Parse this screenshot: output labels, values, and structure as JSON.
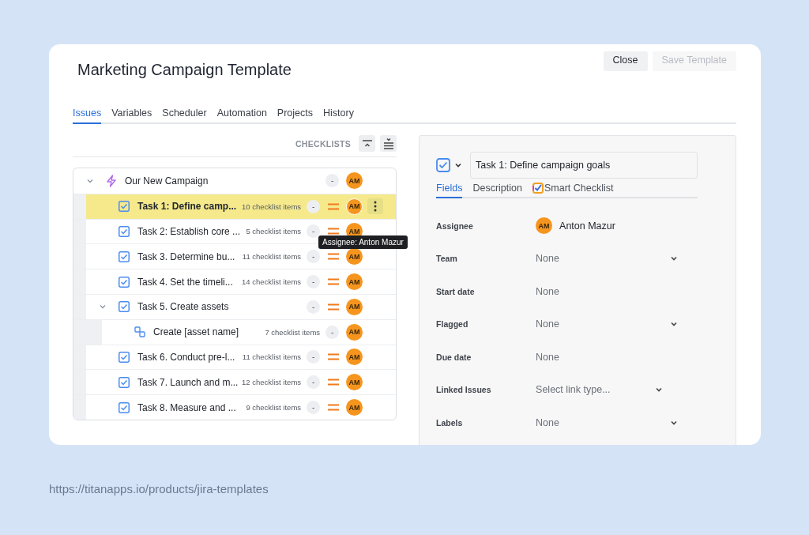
{
  "dialog": {
    "title": "Marketing Campaign Template",
    "buttons": [
      {
        "label": "Close",
        "disabled": false
      },
      {
        "label": "Save Template",
        "disabled": true
      }
    ]
  },
  "tabs": [
    {
      "label": "Issues",
      "selected": true
    },
    {
      "label": "Variables",
      "selected": false
    },
    {
      "label": "Scheduler",
      "selected": false
    },
    {
      "label": "Automation",
      "selected": false
    },
    {
      "label": "Projects",
      "selected": false
    },
    {
      "label": "History",
      "selected": false
    }
  ],
  "checklists_toolbar": {
    "label": "CHECKLISTS"
  },
  "tree": [
    {
      "kind": "epic",
      "title": "Our New Campaign",
      "status": "-",
      "assignee": "AM",
      "expanded": true,
      "selected": false,
      "children": [
        {
          "kind": "task",
          "title": "Task 1: Define camp...",
          "checklist": "10 checklist items",
          "status": "-",
          "priority": true,
          "assignee": "AM",
          "selected": true
        },
        {
          "kind": "task",
          "title": "Task 2: Establish core ...",
          "checklist": "5 checklist items",
          "status": "-",
          "priority": true,
          "assignee": "AM",
          "selected": false
        },
        {
          "kind": "task",
          "title": "Task 3. Determine bu...",
          "checklist": "11 checklist items",
          "status": "-",
          "priority": true,
          "assignee": "AM",
          "selected": false
        },
        {
          "kind": "task",
          "title": "Task 4. Set the timeli...",
          "checklist": "14 checklist items",
          "status": "-",
          "priority": true,
          "assignee": "AM",
          "selected": false
        },
        {
          "kind": "task",
          "title": "Task 5. Create assets",
          "status": "-",
          "priority": true,
          "assignee": "AM",
          "expanded": true,
          "selected": false,
          "children": [
            {
              "kind": "subtask",
              "title": "Create [asset name]",
              "checklist": "7 checklist items",
              "status": "-",
              "assignee": "AM",
              "selected": false
            }
          ]
        },
        {
          "kind": "task",
          "title": "Task 6. Conduct pre-l...",
          "checklist": "11 checklist items",
          "status": "-",
          "priority": true,
          "assignee": "AM",
          "selected": false
        },
        {
          "kind": "task",
          "title": "Task 7. Launch and m...",
          "checklist": "12 checklist items",
          "status": "-",
          "priority": true,
          "assignee": "AM",
          "selected": false
        },
        {
          "kind": "task",
          "title": "Task 8. Measure and ...",
          "checklist": "9 checklist items",
          "status": "-",
          "priority": true,
          "assignee": "AM",
          "selected": false
        }
      ]
    }
  ],
  "tooltip": "Assignee: Anton Mazur",
  "detail": {
    "summary": "Task 1: Define campaign goals",
    "tabs": [
      {
        "label": "Fields",
        "selected": true
      },
      {
        "label": "Description",
        "selected": false
      },
      {
        "label": "Smart Checklist",
        "selected": false
      }
    ],
    "fields": [
      {
        "kind": "user",
        "label": "Assignee",
        "avatar": "AM",
        "value": "Anton Mazur"
      },
      {
        "kind": "dropdown",
        "label": "Team",
        "value": "None"
      },
      {
        "kind": "text",
        "label": "Start date",
        "value": "None"
      },
      {
        "kind": "dropdown",
        "label": "Flagged",
        "value": "None"
      },
      {
        "kind": "text",
        "label": "Due date",
        "value": "None"
      },
      {
        "kind": "short-dropdown",
        "label": "Linked Issues",
        "value": "Select link type..."
      },
      {
        "kind": "dropdown",
        "label": "Labels",
        "value": "None"
      }
    ]
  },
  "footer_url": "https://titanapps.io/products/jira-templates"
}
